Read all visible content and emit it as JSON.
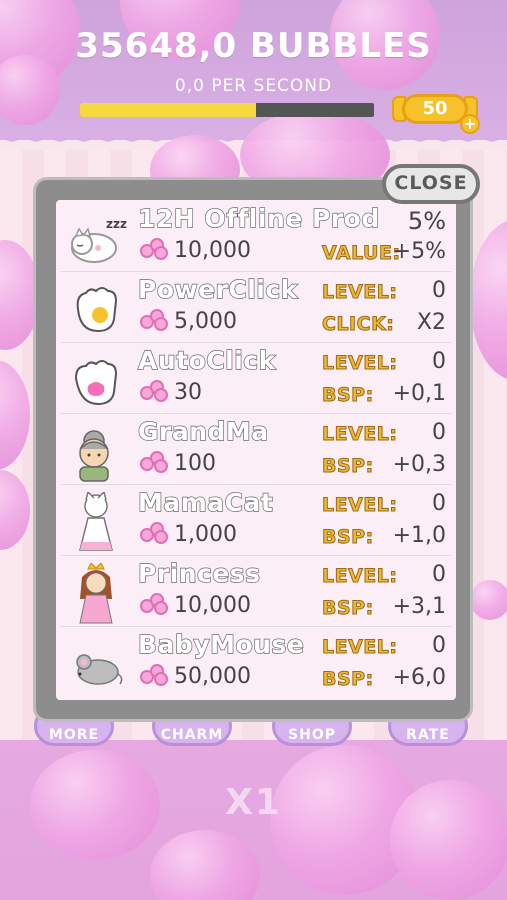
{
  "header": {
    "bubbles": "35648,0 BUBBLES",
    "per_second": "0,0 PER SECOND",
    "progress": 0.6,
    "candy_count": "50",
    "candy_plus": "+"
  },
  "panel": {
    "close_label": "CLOSE",
    "items": [
      {
        "name": "12H Offline Prod",
        "cost": "10,000",
        "top_label": "",
        "top_value": "5%",
        "bottom_label": "VALUE:",
        "bottom_value": "+5%",
        "icon": "sleeping-cat-icon"
      },
      {
        "name": "PowerClick",
        "cost": "5,000",
        "top_label": "LEVEL:",
        "top_value": "0",
        "bottom_label": "CLICK:",
        "bottom_value": "X2",
        "icon": "yellow-paw-icon"
      },
      {
        "name": "AutoClick",
        "cost": "30",
        "top_label": "LEVEL:",
        "top_value": "0",
        "bottom_label": "BSP:",
        "bottom_value": "+0,1",
        "icon": "pink-paw-icon"
      },
      {
        "name": "GrandMa",
        "cost": "100",
        "top_label": "LEVEL:",
        "top_value": "0",
        "bottom_label": "BSP:",
        "bottom_value": "+0,3",
        "icon": "grandma-icon"
      },
      {
        "name": "MamaCat",
        "cost": "1,000",
        "top_label": "LEVEL:",
        "top_value": "0",
        "bottom_label": "BSP:",
        "bottom_value": "+1,0",
        "icon": "mama-cat-icon"
      },
      {
        "name": "Princess",
        "cost": "10,000",
        "top_label": "LEVEL:",
        "top_value": "0",
        "bottom_label": "BSP:",
        "bottom_value": "+3,1",
        "icon": "princess-icon"
      },
      {
        "name": "BabyMouse",
        "cost": "50,000",
        "top_label": "LEVEL:",
        "top_value": "0",
        "bottom_label": "BSP:",
        "bottom_value": "+6,0",
        "icon": "mouse-icon"
      }
    ]
  },
  "nav": {
    "more": "MORE",
    "charm": "CHARM",
    "shop": "SHOP",
    "rate": "RATE"
  },
  "multiplier": "X1"
}
